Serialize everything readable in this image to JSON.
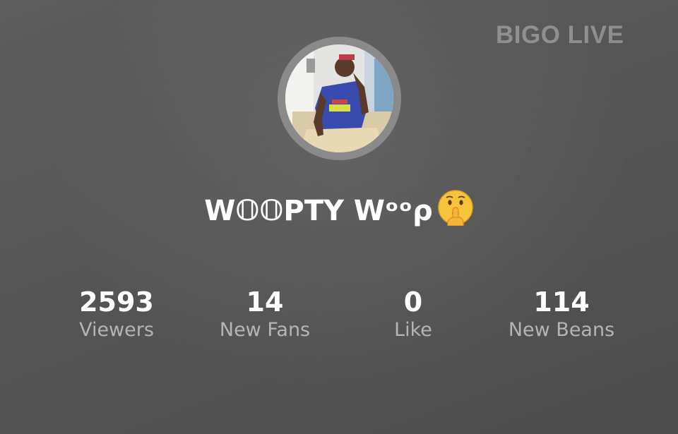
{
  "watermark": "BIGO LIVE",
  "profile": {
    "username": "W𝕆𝕆PTY Wᵒᵒρ",
    "username_emoji": "shushing-face-emoji"
  },
  "stats": [
    {
      "value": "2593",
      "label": "Viewers"
    },
    {
      "value": "14",
      "label": "New Fans"
    },
    {
      "value": "0",
      "label": "Like"
    },
    {
      "value": "114",
      "label": "New Beans"
    }
  ],
  "colors": {
    "background": "#585858",
    "avatar_ring": "#8a8a8a",
    "label": "#cdcdcd",
    "watermark": "#bebebe"
  }
}
